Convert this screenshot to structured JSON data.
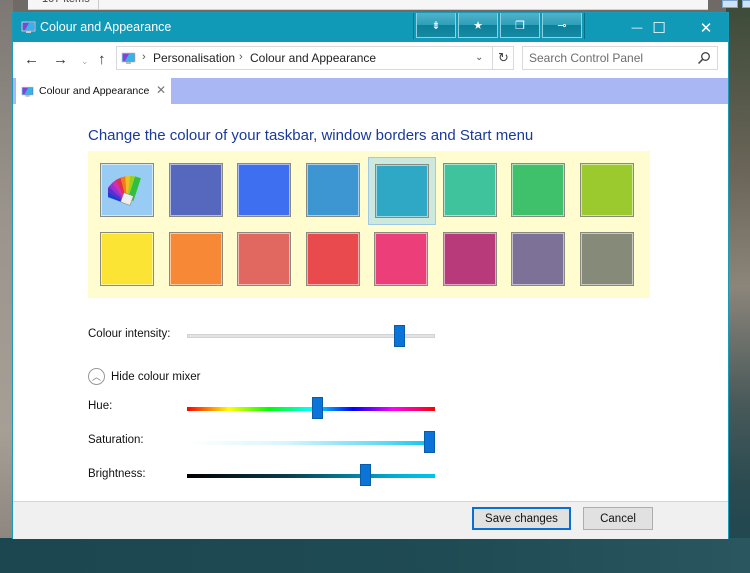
{
  "background_window": {
    "status_text": "107 items"
  },
  "window": {
    "title": "Colour and Appearance",
    "title_icon": "colour-and-appearance-icon",
    "accent_color": "#109ab8",
    "extra_title_buttons": [
      {
        "name": "collapse-ribbon",
        "glyph": "⇟"
      },
      {
        "name": "favorites",
        "glyph": "★"
      },
      {
        "name": "window-history",
        "glyph": "❐"
      },
      {
        "name": "pin",
        "glyph": "⊸"
      }
    ],
    "controls": {
      "minimize": "—",
      "maximize": "☐",
      "close": "✕"
    }
  },
  "navigation": {
    "back": "←",
    "forward": "→",
    "recent": "⌄",
    "up": "↑",
    "breadcrumb": [
      {
        "label": "Personalisation"
      },
      {
        "label": "Colour and Appearance"
      }
    ],
    "breadcrumb_separator": "›",
    "dropdown_glyph": "⌄",
    "refresh_glyph": "↻",
    "search": {
      "placeholder": "Search Control Panel",
      "value": ""
    }
  },
  "tabs": [
    {
      "label": "Colour and Appearance",
      "close": "✕",
      "active": true
    }
  ],
  "tabstrip_color": "#a9b8f5",
  "content": {
    "heading": "Change the colour of your taskbar, window borders and Start menu",
    "palette_background": "#fffdd0",
    "swatches": [
      {
        "name": "custom",
        "color": "#99ccf5",
        "custom": true
      },
      {
        "name": "slate-blue",
        "color": "#5568bd"
      },
      {
        "name": "blue",
        "color": "#3d6ff0"
      },
      {
        "name": "sky-blue",
        "color": "#3d96d2"
      },
      {
        "name": "teal",
        "color": "#2ea8c4",
        "selected": true
      },
      {
        "name": "aqua-green",
        "color": "#3fc39c"
      },
      {
        "name": "green",
        "color": "#3fc16c"
      },
      {
        "name": "lime",
        "color": "#9aca2e"
      },
      {
        "name": "yellow",
        "color": "#fbe434"
      },
      {
        "name": "orange",
        "color": "#f78836"
      },
      {
        "name": "salmon",
        "color": "#e06860"
      },
      {
        "name": "red",
        "color": "#e94a4e"
      },
      {
        "name": "pink",
        "color": "#ec3e78"
      },
      {
        "name": "magenta",
        "color": "#b83a7a"
      },
      {
        "name": "purple-grey",
        "color": "#7d7198"
      },
      {
        "name": "olive-grey",
        "color": "#868b79"
      }
    ],
    "colour_intensity": {
      "label": "Colour intensity:",
      "value": 0.86
    },
    "mixer_toggle": {
      "label": "Hide colour mixer",
      "glyph": "︿"
    },
    "hue": {
      "label": "Hue:",
      "value": 0.53
    },
    "saturation": {
      "label": "Saturation:",
      "value": 0.98
    },
    "brightness": {
      "label": "Brightness:",
      "value": 0.72
    }
  },
  "footer": {
    "save_label": "Save changes",
    "cancel_label": "Cancel"
  }
}
